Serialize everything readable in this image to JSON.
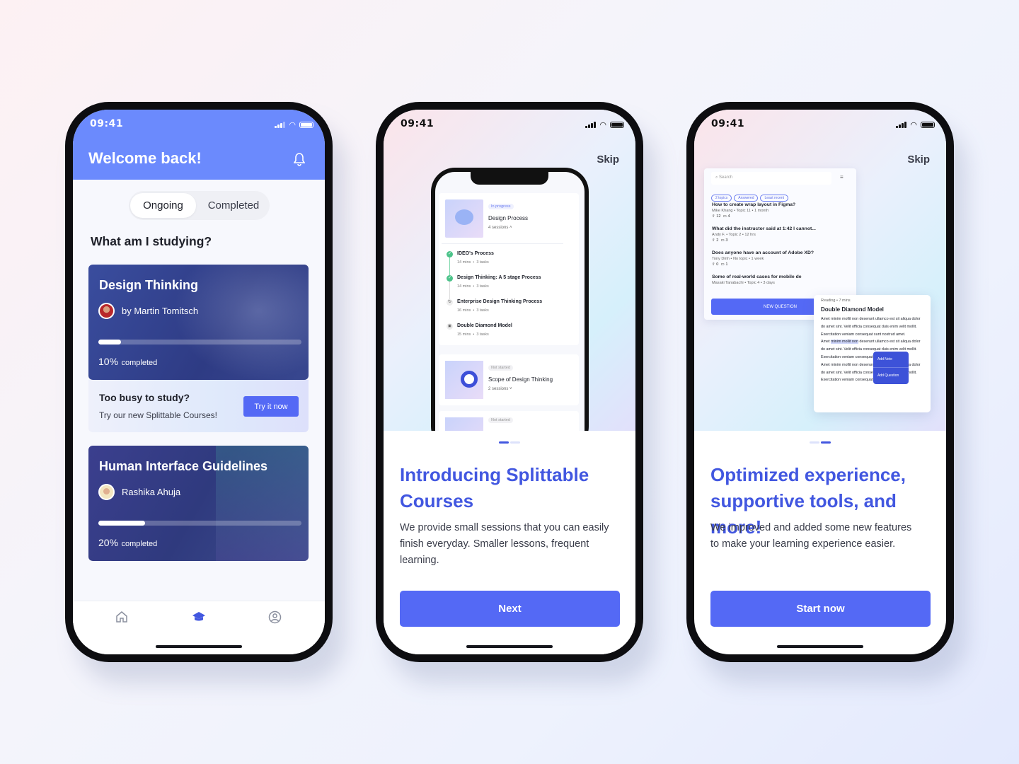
{
  "status_time": "09:41",
  "colors": {
    "accent": "#5469f5",
    "header": "#6b8afd",
    "title": "#4257e0",
    "success": "#4cc38a"
  },
  "phone1": {
    "header_title": "Welcome back!",
    "bell_icon": "bell-icon",
    "tabs": [
      {
        "label": "Ongoing",
        "active": true
      },
      {
        "label": "Completed",
        "active": false
      }
    ],
    "section_title": "What am I studying?",
    "courses": [
      {
        "title": "Design Thinking",
        "author": "by Martin Tomitsch",
        "progress_percent": 10,
        "progress_value": "10%",
        "progress_suffix": "completed"
      },
      {
        "title": "Human Interface Guidelines",
        "author": "Rashika Ahuja",
        "progress_percent": 20,
        "progress_value": "20%",
        "progress_suffix": "completed"
      }
    ],
    "promo": {
      "title": "Too busy to study?",
      "subtitle": "Try our new Splittable Courses!",
      "button": "Try it now"
    },
    "nav": [
      {
        "icon": "home-icon",
        "active": false
      },
      {
        "icon": "graduation-cap-icon",
        "active": true
      },
      {
        "icon": "user-circle-icon",
        "active": false
      }
    ]
  },
  "phone2": {
    "skip": "Skip",
    "title": "Introducing Splittable Courses",
    "body": "We provide small sessions that you can easily finish everyday. Smaller lessons, frequent learning.",
    "button": "Next",
    "page_index": 1,
    "mock": {
      "course1": {
        "badge": "In progress",
        "title": "Design Process",
        "sessions": "4 sessions"
      },
      "sessions": [
        {
          "title": "IDEO's Process",
          "mins": "14 mins",
          "tasks": "3 tasks",
          "state": "done"
        },
        {
          "title": "Design Thinking: A 5 stage Process",
          "mins": "14 mins",
          "tasks": "3 tasks",
          "state": "done"
        },
        {
          "title": "Enterprise Design Thinking Process",
          "mins": "16 mins",
          "tasks": "3 tasks",
          "state": "in-progress"
        },
        {
          "title": "Double Diamond Model",
          "mins": "15 mins",
          "tasks": "3 tasks",
          "state": "locked"
        }
      ],
      "course2": {
        "badge": "Not started",
        "title": "Scope of Design Thinking",
        "sessions": "2 sessions"
      },
      "course3": {
        "badge": "Not started"
      }
    }
  },
  "phone3": {
    "skip": "Skip",
    "title": "Optimized experience, supportive tools, and more!",
    "body": "We improved and added some new features to make your learning experience easier.",
    "button": "Start now",
    "page_index": 2,
    "qa": {
      "search_placeholder": "Search",
      "chips": [
        "2 topics",
        "Answered",
        "Least recent"
      ],
      "questions": [
        {
          "title": "How to create wrap layout in Figma?",
          "meta": "Mike Khang  •  Topic 11  •  1 month",
          "votes": "12",
          "comments": "4"
        },
        {
          "title": "What did the instructor said at 1:42 I cannot...",
          "meta": "Andy F.  •  Topic 2  •  12 hrs",
          "votes": "2",
          "comments": "3"
        },
        {
          "title": "Does anyone have an account of Adobe XD?",
          "meta": "Tony Dinh  •  No topic  •  1 week",
          "votes": "0",
          "comments": "1"
        },
        {
          "title": "Some of real-world cases for mobile de",
          "meta": "Masaki Tanabachi  •  Topic 4  •  3 days"
        }
      ],
      "button": "NEW QUESTION"
    },
    "reading": {
      "meta": "Reading  •  7 mins",
      "title": "Double Diamond Model",
      "p1": "Amet minim mollit non deserunt ullamco est sit aliqua dolor do amet sint. Velit officia consequat duis enim velit mollit. Exercitation veniam consequat sunt nostrud amet.",
      "p2_pre": "Amet ",
      "p2_highlight": "minim mollit non",
      "p2_post": " deserunt ullamco est sit aliqua dolor do amet sint. Velit officia consequat duis enim velit mollit. Exercitation veniam consequat sunt nostrud amet.",
      "p3": "Amet minim mollit non deserunt ullamco est sit aliqua dolor do amet sint. Velit officia consequat duis enim velit mollit. Exercitation veniam consequat sunt nostrud amet.",
      "menu": [
        "Add Note",
        "Add Question"
      ]
    }
  }
}
